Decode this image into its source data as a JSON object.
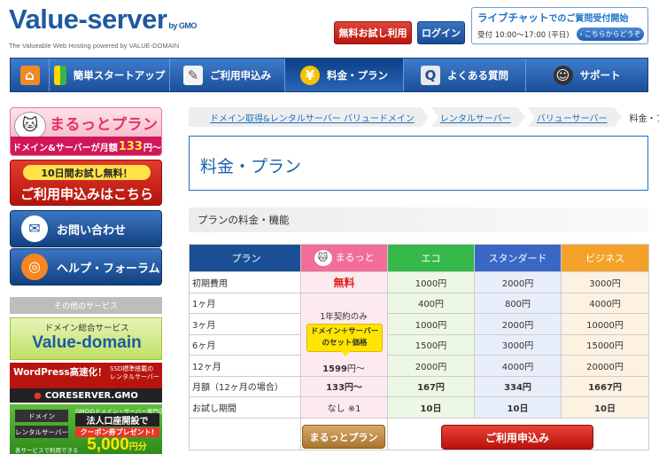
{
  "header": {
    "logo_text": "Value-server",
    "logo_suffix": "by GMO",
    "logo_tagline": "The Valueable Web Hosting powered by VALUE-DOMAIN",
    "trial_button": "無料お試し利用",
    "login_button": "ログイン",
    "chat_title_main": "ライブチャット",
    "chat_title_rest": "でのご質問受付開始",
    "chat_hours": "受付 10:00～17:00 (平日)",
    "chat_link": "こちらからどうぞ"
  },
  "nav": {
    "items": [
      {
        "label": "",
        "icon": "home-icon"
      },
      {
        "label": "簡単スタートアップ",
        "icon": "beginner-icon"
      },
      {
        "label": "ご利用申込み",
        "icon": "form-icon"
      },
      {
        "label": "料金・プラン",
        "icon": "yen-icon"
      },
      {
        "label": "よくある質問",
        "icon": "faq-icon"
      },
      {
        "label": "サポート",
        "icon": "support-icon"
      }
    ]
  },
  "sidebar": {
    "maru_title": "まるっとプラン",
    "maru_bar_pre": "ドメイン&サーバーが月額",
    "maru_bar_price": "133",
    "maru_bar_post": "円～",
    "trial_top": "10日間お試し無料！",
    "trial_main": "ご利用申込みはこちら",
    "contact": "お問い合わせ",
    "help": "ヘルプ・フォーラム",
    "other_services": "その他のサービス",
    "vd_title": "ドメイン総合サービス",
    "vd_logo": "Value-domain",
    "cs_title": "WordPress高速化！",
    "cs_sub1": "SSD標準搭載の",
    "cs_sub2": "レンタルサーバー",
    "cs_logo": "CORESERVER.GMO",
    "gmo_box1": "ドメイン",
    "gmo_box2": "レンタルサーバー",
    "gmo_r1": "GMOのドメイン・サーバー専門店",
    "gmo_r2": "法人口座開設で",
    "gmo_r3": "クーポン券プレゼント!",
    "gmo_amount": "5,000",
    "gmo_unit": "円分",
    "gmo_note": "各サービスで利用できる"
  },
  "breadcrumb": {
    "items": [
      "ドメイン取得&レンタルサーバー バリュードメイン",
      "レンタルサーバー",
      "バリューサーバー"
    ],
    "current": "料金・プラン"
  },
  "page_title": "料金・プラン",
  "section_title": "プランの料金・機能",
  "table": {
    "headers": [
      "プラン",
      "まるっと",
      "エコ",
      "スタンダード",
      "ビジネス"
    ],
    "rows": [
      {
        "label": "初期費用",
        "maru": "無料",
        "eco": "1000円",
        "std": "2000円",
        "biz": "3000円"
      },
      {
        "label": "1ヶ月",
        "eco": "400円",
        "std": "800円",
        "biz": "4000円"
      },
      {
        "label": "3ヶ月",
        "eco": "1000円",
        "std": "2000円",
        "biz": "10000円"
      },
      {
        "label": "6ヶ月",
        "eco": "1500円",
        "std": "3000円",
        "biz": "15000円"
      },
      {
        "label": "12ヶ月",
        "eco": "2000円",
        "std": "4000円",
        "biz": "20000円"
      },
      {
        "label": "月額（12ヶ月の場合）",
        "maru": "133円～",
        "eco": "167円",
        "std": "334円",
        "biz": "1667円"
      },
      {
        "label": "お試し期間",
        "maru": "なし ※1",
        "eco": "10日",
        "std": "10日",
        "biz": "10日"
      }
    ],
    "maru_note": "1年契約のみ",
    "maru_badge_line1": "ドメイン＋サーバー",
    "maru_badge_line2": "のセット価格",
    "maru_price_num": "1599",
    "maru_price_unit": "円～"
  },
  "buttons": {
    "maru_plan": "まるっとプラン",
    "apply": "ご利用申込み"
  }
}
